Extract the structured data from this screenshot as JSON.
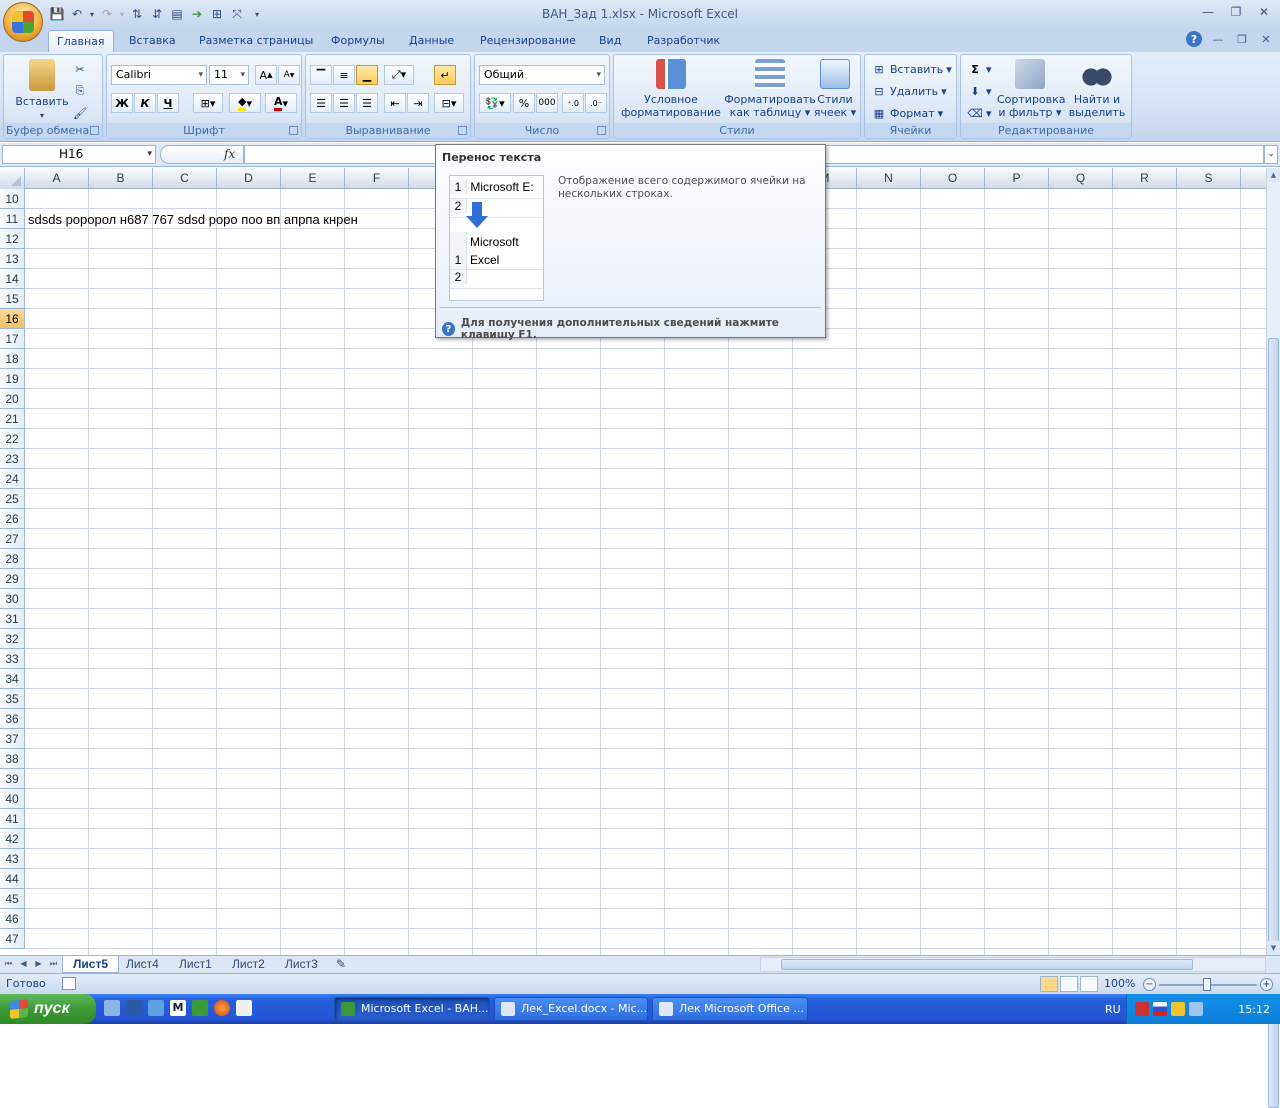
{
  "window": {
    "title": "ВАН_Зад 1.xlsx - Microsoft Excel"
  },
  "quick_access": [
    "save-icon",
    "undo-icon",
    "redo-icon",
    "sort-asc-icon",
    "sort-desc-icon",
    "form-icon",
    "arrow-icon",
    "border-icon",
    "fit-icon"
  ],
  "tabs": [
    {
      "label": "Главная",
      "active": true
    },
    {
      "label": "Вставка"
    },
    {
      "label": "Разметка страницы"
    },
    {
      "label": "Формулы"
    },
    {
      "label": "Данные"
    },
    {
      "label": "Рецензирование"
    },
    {
      "label": "Вид"
    },
    {
      "label": "Разработчик"
    }
  ],
  "ribbon": {
    "clipboard": {
      "label": "Буфер обмена",
      "paste": "Вставить"
    },
    "font": {
      "label": "Шрифт",
      "name": "Calibri",
      "size": "11",
      "bold": "Ж",
      "italic": "К",
      "underline": "Ч"
    },
    "alignment": {
      "label": "Выравнивание"
    },
    "number": {
      "label": "Число",
      "format": "Общий",
      "percent": "%",
      "thousands": "000"
    },
    "styles": {
      "label": "Стили",
      "conditional": "Условное форматирование",
      "as_table": "Форматировать как таблицу",
      "cell_styles": "Стили ячеек"
    },
    "cells": {
      "label": "Ячейки",
      "insert": "Вставить",
      "delete": "Удалить",
      "format": "Формат"
    },
    "editing": {
      "label": "Редактирование",
      "sort": "Сортировка и фильтр",
      "find": "Найти и выделить"
    }
  },
  "formula_bar": {
    "name_box": "H16",
    "fx": "fx",
    "value": ""
  },
  "grid": {
    "columns": [
      "A",
      "B",
      "C",
      "D",
      "E",
      "F",
      "G",
      "H",
      "I",
      "J",
      "K",
      "L",
      "M",
      "N",
      "O",
      "P",
      "Q",
      "R",
      "S"
    ],
    "rows": [
      "10",
      "11",
      "12",
      "13",
      "14",
      "15",
      "16",
      "17",
      "18",
      "19",
      "20",
      "21",
      "22",
      "23",
      "24",
      "25",
      "26",
      "27",
      "28",
      "29",
      "30",
      "31",
      "32",
      "33",
      "34",
      "35",
      "36",
      "37",
      "38",
      "39",
      "40",
      "41",
      "42",
      "43",
      "44",
      "45",
      "46",
      "47"
    ],
    "selected_row": "16",
    "cell_A11": "sdsds роророл н687 767  sdsd роро поо вп апрпа кнрен"
  },
  "tooltip": {
    "title": "Перенос текста",
    "sample_before": "Microsoft E:",
    "sample_after_1": "Microsoft",
    "sample_after_2": "Excel",
    "row1": "1",
    "row2": "2",
    "description": "Отображение всего содержимого ячейки на нескольких строках.",
    "help": "Для получения дополнительных сведений нажмите клавишу F1."
  },
  "sheets": [
    {
      "label": "Лист5",
      "active": true
    },
    {
      "label": "Лист4"
    },
    {
      "label": "Лист1"
    },
    {
      "label": "Лист2"
    },
    {
      "label": "Лист3"
    }
  ],
  "status": {
    "ready": "Готово",
    "zoom": "100%"
  },
  "taskbar": {
    "start": "пуск",
    "tasks": [
      {
        "label": "Microsoft Excel - ВАН...",
        "active": true
      },
      {
        "label": "Лек_Excel.docx - Mic..."
      },
      {
        "label": "Лек Microsoft Office ..."
      }
    ],
    "lang": "RU",
    "clock": "15:12"
  },
  "colors": {
    "accent": "#15428b",
    "selected_row": "#f1c15f",
    "taskbar": "#245edb"
  }
}
